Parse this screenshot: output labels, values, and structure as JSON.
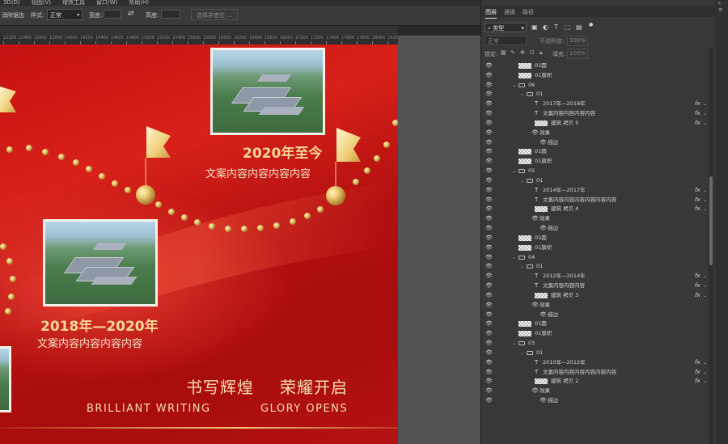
{
  "menubar": {
    "items": [
      "3D(D)",
      "视图(V)",
      "增效工具",
      "窗口(W)",
      "帮助(H)"
    ]
  },
  "options_bar": {
    "feather_label": "消除锯齿",
    "style_label": "样式:",
    "style_value": "正常",
    "width_label": "宽度:",
    "height_label": "高度:",
    "select_subject_button": "选择并遮住 ..."
  },
  "ruler": {
    "ticks": [
      "12200",
      "12400",
      "12600",
      "12800",
      "14000",
      "14200",
      "14400",
      "14600",
      "14800",
      "15000",
      "15200",
      "15400",
      "15600",
      "15800",
      "16000",
      "16200",
      "16400",
      "16600",
      "16800",
      "17000",
      "17200",
      "17400",
      "17600",
      "17800",
      "18000",
      "18200"
    ]
  },
  "canvas": {
    "milestone_top": {
      "year": "2020年至今",
      "text": "文案内容内容内容内容"
    },
    "milestone_mid": {
      "year": "2018年—2020年",
      "text": "文案内容内容内容内容"
    },
    "slogan_cn_1": "书写辉煌",
    "slogan_cn_2": "荣耀开启",
    "slogan_en_1": "BRILLIANT WRITING",
    "slogan_en_2": "GLORY OPENS",
    "colors": {
      "bg_red": "#c51111",
      "gold": "#f1cf78",
      "title_gold": "#f7d795"
    }
  },
  "panel": {
    "tabs": [
      "图层",
      "通道",
      "路径"
    ],
    "active_tab": "图层",
    "kind_filter": "类型",
    "blend_mode": "正常",
    "opacity_label": "不透明度:",
    "opacity_value": "100%",
    "lock_label": "锁定:",
    "fill_label": "填充:",
    "fill_value": "100%",
    "layers": [
      {
        "indent": 0,
        "type": "pix",
        "name": "01圆",
        "fx": false
      },
      {
        "indent": 0,
        "type": "pix",
        "name": "01旗帜",
        "fx": false
      },
      {
        "indent": 0,
        "type": "group",
        "name": "06",
        "fx": false
      },
      {
        "indent": 1,
        "type": "group",
        "name": "01",
        "fx": false
      },
      {
        "indent": 2,
        "type": "text",
        "name": "2017年—2018年",
        "fx": true
      },
      {
        "indent": 2,
        "type": "text",
        "name": "文案内容内容内容内容",
        "fx": true
      },
      {
        "indent": 2,
        "type": "pix",
        "name": "建筑 拷贝 5",
        "fx": true
      },
      {
        "indent": 3,
        "type": "effects",
        "name": "效果",
        "fx": false
      },
      {
        "indent": 4,
        "type": "effect",
        "name": "描边",
        "fx": false
      },
      {
        "indent": 0,
        "type": "pix",
        "name": "01圆",
        "fx": false
      },
      {
        "indent": 0,
        "type": "pix",
        "name": "01旗帜",
        "fx": false
      },
      {
        "indent": 0,
        "type": "group",
        "name": "05",
        "fx": false
      },
      {
        "indent": 1,
        "type": "group",
        "name": "01",
        "fx": false
      },
      {
        "indent": 2,
        "type": "text",
        "name": "2014年—2017年",
        "fx": true
      },
      {
        "indent": 2,
        "type": "text",
        "name": "文案内容内容内容内容内容内容",
        "fx": true
      },
      {
        "indent": 2,
        "type": "pix",
        "name": "建筑 拷贝 4",
        "fx": true
      },
      {
        "indent": 3,
        "type": "effects",
        "name": "效果",
        "fx": false
      },
      {
        "indent": 4,
        "type": "effect",
        "name": "描边",
        "fx": false
      },
      {
        "indent": 0,
        "type": "pix",
        "name": "01圆",
        "fx": false
      },
      {
        "indent": 0,
        "type": "pix",
        "name": "01旗帜",
        "fx": false
      },
      {
        "indent": 0,
        "type": "group",
        "name": "04",
        "fx": false
      },
      {
        "indent": 1,
        "type": "group",
        "name": "01",
        "fx": false
      },
      {
        "indent": 2,
        "type": "text",
        "name": "2012年—2014年",
        "fx": true
      },
      {
        "indent": 2,
        "type": "text",
        "name": "文案内容内容内容",
        "fx": true
      },
      {
        "indent": 2,
        "type": "pix",
        "name": "建筑 拷贝 3",
        "fx": true
      },
      {
        "indent": 3,
        "type": "effects",
        "name": "效果",
        "fx": false
      },
      {
        "indent": 4,
        "type": "effect",
        "name": "描边",
        "fx": false
      },
      {
        "indent": 0,
        "type": "pix",
        "name": "01圆",
        "fx": false
      },
      {
        "indent": 0,
        "type": "pix",
        "name": "01旗帜",
        "fx": false
      },
      {
        "indent": 0,
        "type": "group",
        "name": "03",
        "fx": false
      },
      {
        "indent": 1,
        "type": "group",
        "name": "01",
        "fx": false
      },
      {
        "indent": 2,
        "type": "text",
        "name": "2010年—2012年",
        "fx": true
      },
      {
        "indent": 2,
        "type": "text",
        "name": "文案内容内容内容内容内容内容",
        "fx": true
      },
      {
        "indent": 2,
        "type": "pix",
        "name": "建筑 拷贝 2",
        "fx": true
      },
      {
        "indent": 3,
        "type": "effects",
        "name": "效果",
        "fx": false
      },
      {
        "indent": 4,
        "type": "effect",
        "name": "描边",
        "fx": false
      }
    ]
  }
}
